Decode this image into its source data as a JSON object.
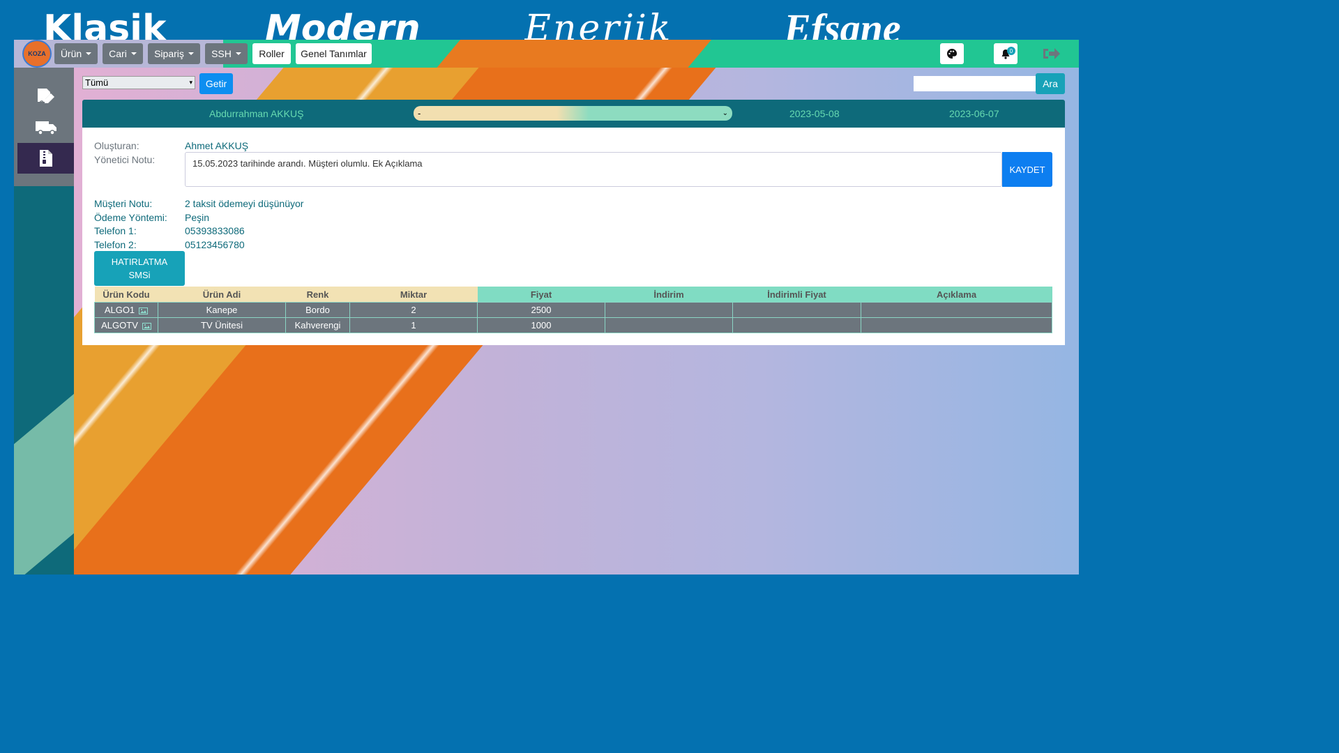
{
  "themes": [
    "Klasik",
    "Modern",
    "Enerjik",
    "Efsane"
  ],
  "logo_text": "KOZA",
  "nav": {
    "urun": "Ürün",
    "cari": "Cari",
    "siparis": "Sipariş",
    "ssh": "SSH",
    "roller": "Roller",
    "genel": "Genel Tanımlar",
    "notif_count": "0"
  },
  "toolbar": {
    "filter_value": "Tümü",
    "getir": "Getir",
    "search_value": "",
    "ara": "Ara"
  },
  "header": {
    "name": "Abdurrahman AKKUŞ",
    "status_value": "-",
    "date1": "2023-05-08",
    "date2": "2023-06-07"
  },
  "details": {
    "olusturan_label": "Oluşturan:",
    "olusturan_value": "Ahmet AKKUŞ",
    "yonetici_label": "Yönetici Notu:",
    "yonetici_value": "15.05.2023 tarihinde arandı. Müşteri olumlu. Ek Açıklama",
    "kaydet": "KAYDET",
    "musteri_label": "Müşteri Notu:",
    "musteri_value": "2 taksit ödemeyi düşünüyor",
    "odeme_label": "Ödeme Yöntemi:",
    "odeme_value": "Peşin",
    "tel1_label": "Telefon 1:",
    "tel1_value": "05393833086",
    "tel2_label": "Telefon 2:",
    "tel2_value": "05123456780",
    "sms_line1": "HATIRLATMA",
    "sms_line2": "SMSi"
  },
  "table": {
    "columns": [
      "Ürün Kodu",
      "Ürün Adi",
      "Renk",
      "Miktar",
      "Fiyat",
      "İndirim",
      "İndirimli Fiyat",
      "Açıklama"
    ],
    "rows": [
      [
        "ALGO1",
        "Kanepe",
        "Bordo",
        "2",
        "2500",
        "",
        "",
        ""
      ],
      [
        "ALGOTV",
        "TV Ünitesi",
        "Kahverengi",
        "1",
        "1000",
        "",
        "",
        ""
      ]
    ]
  },
  "colors": {
    "frame": "#0471b0",
    "navbar": "#21c693",
    "header": "#0e6a7a",
    "primary": "#0d8ef0",
    "info": "#17a2b8",
    "secondary": "#6c757d"
  }
}
